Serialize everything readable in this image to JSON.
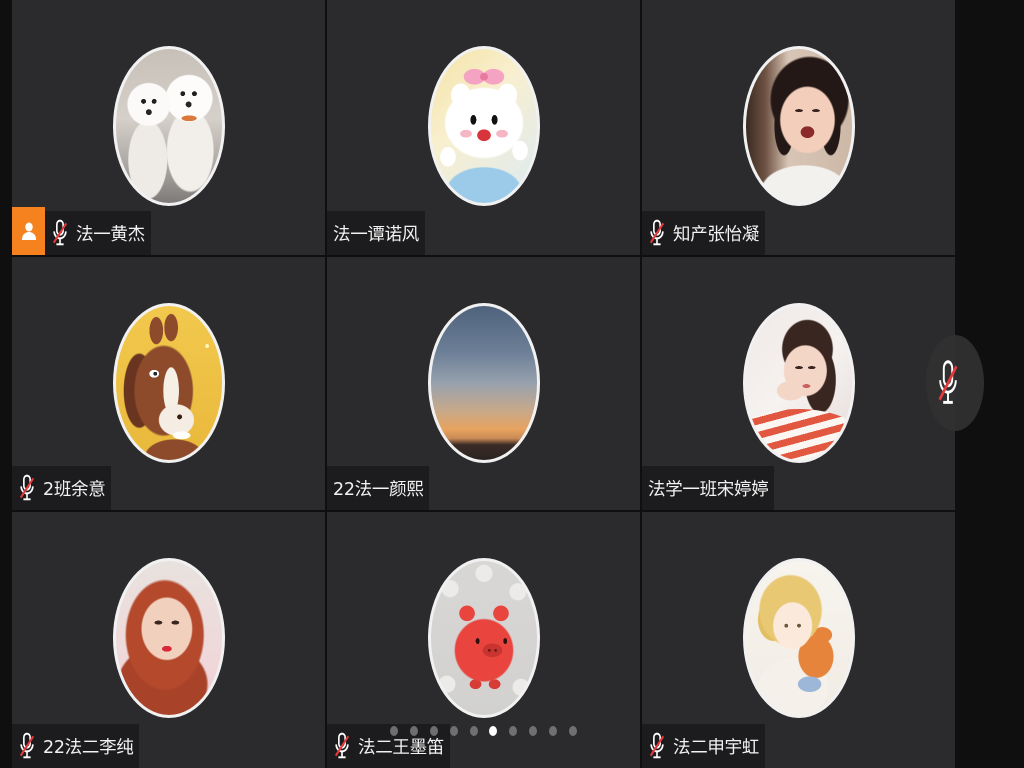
{
  "participants": [
    {
      "name": "法一黄杰",
      "muted": true,
      "host": true
    },
    {
      "name": "法一谭诺风",
      "muted": false,
      "host": false
    },
    {
      "name": "知产张怡凝",
      "muted": true,
      "host": false
    },
    {
      "name": "2班余意",
      "muted": true,
      "host": false
    },
    {
      "name": "22法一颜熙",
      "muted": false,
      "host": false
    },
    {
      "name": "法学一班宋婷婷",
      "muted": false,
      "host": false
    },
    {
      "name": "22法二李纯",
      "muted": true,
      "host": false
    },
    {
      "name": "法二王墨笛",
      "muted": true,
      "host": false
    },
    {
      "name": "法二申宇虹",
      "muted": true,
      "host": false
    }
  ],
  "icons": {
    "muted_mic": "mic-muted-icon",
    "host": "person-icon"
  },
  "pager": {
    "page_count": 10,
    "current_page": 6
  },
  "floating_mic": {
    "muted": true,
    "icon": "mic-muted-icon"
  },
  "colors": {
    "host_badge": "#f5821f",
    "mic_slash": "#e5393b",
    "page_dot": "#7d7d80",
    "page_dot_active": "#ffffff",
    "tile_bg": "#2b2b2d",
    "label_bg": "#1c1c1e"
  }
}
